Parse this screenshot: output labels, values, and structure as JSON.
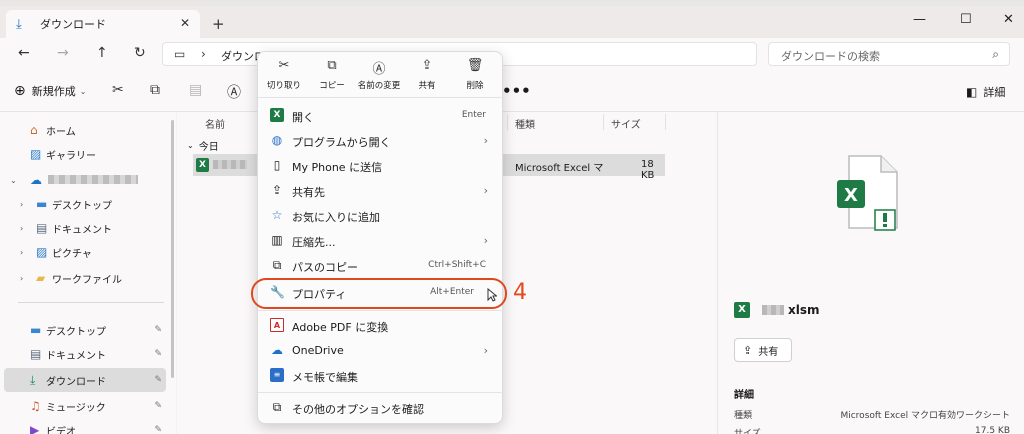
{
  "window": {
    "tab_title": "ダウンロード",
    "tab_close": "✕",
    "new_tab": "+",
    "minimize": "—",
    "maximize": "☐",
    "close": "✕"
  },
  "nav": {
    "back": "←",
    "forward": "→",
    "up": "↑",
    "refresh": "↻"
  },
  "address": {
    "separator": "›",
    "path": "ダウンロード",
    "search_placeholder": "ダウンロードの検索"
  },
  "commandbar": {
    "new_label": "新規作成",
    "more": "•••",
    "details_label": "詳細"
  },
  "sidebar": {
    "items": [
      {
        "label": "ホーム",
        "icon": "home-icon"
      },
      {
        "label": "ギャラリー",
        "icon": "gallery-icon"
      },
      {
        "label": "",
        "icon": "onedrive-icon"
      },
      {
        "label": "デスクトップ",
        "icon": "desktop-icon"
      },
      {
        "label": "ドキュメント",
        "icon": "documents-icon"
      },
      {
        "label": "ピクチャ",
        "icon": "pictures-icon"
      },
      {
        "label": "ワークファイル",
        "icon": "folder-icon"
      }
    ],
    "pinned": [
      {
        "label": "デスクトップ",
        "icon": "desktop-icon"
      },
      {
        "label": "ドキュメント",
        "icon": "documents-icon"
      },
      {
        "label": "ダウンロード",
        "icon": "download-icon",
        "selected": true
      },
      {
        "label": "ミュージック",
        "icon": "music-icon"
      },
      {
        "label": "ビデオ",
        "icon": "video-icon"
      }
    ]
  },
  "filelist": {
    "columns": {
      "name": "名前",
      "type": "種類",
      "size": "サイズ"
    },
    "group_label": "今日",
    "rows": [
      {
        "type": "Microsoft Excel マ",
        "size": "18 KB"
      }
    ]
  },
  "details_pane": {
    "file_ext": "xlsm",
    "share_label": "共有",
    "section_title": "詳細",
    "properties": [
      {
        "label": "種類",
        "value": "Microsoft Excel マクロ有効ワークシート"
      },
      {
        "label": "サイズ",
        "value": "17.5 KB"
      }
    ]
  },
  "context_menu": {
    "actions": [
      {
        "label": "切り取り",
        "icon": "cut-icon"
      },
      {
        "label": "コピー",
        "icon": "copy-icon"
      },
      {
        "label": "名前の変更",
        "icon": "rename-icon"
      },
      {
        "label": "共有",
        "icon": "share-icon"
      },
      {
        "label": "削除",
        "icon": "delete-icon"
      }
    ],
    "items": [
      {
        "label": "開く",
        "shortcut": "Enter",
        "icon": "excel-icon"
      },
      {
        "label": "プログラムから開く",
        "arrow": "›",
        "icon": "open-with-icon"
      },
      {
        "label": "My Phone に送信",
        "icon": "phone-icon"
      },
      {
        "label": "共有先",
        "arrow": "›",
        "icon": "share-to-icon"
      },
      {
        "label": "お気に入りに追加",
        "icon": "star-icon"
      },
      {
        "label": "圧縮先...",
        "arrow": "›",
        "icon": "zip-icon"
      },
      {
        "label": "パスのコピー",
        "shortcut": "Ctrl+Shift+C",
        "icon": "copy-path-icon"
      },
      {
        "label": "プロパティ",
        "shortcut": "Alt+Enter",
        "icon": "wrench-icon"
      },
      {
        "label": "Adobe PDF に変換",
        "icon": "pdf-icon"
      },
      {
        "label": "OneDrive",
        "arrow": "›",
        "icon": "cloud-icon"
      },
      {
        "label": "メモ帳で編集",
        "icon": "notepad-icon"
      },
      {
        "label": "その他のオプションを確認",
        "icon": "more-options-icon"
      }
    ]
  },
  "annotation": {
    "step_number": "4",
    "accent_color": "#e0481f"
  }
}
